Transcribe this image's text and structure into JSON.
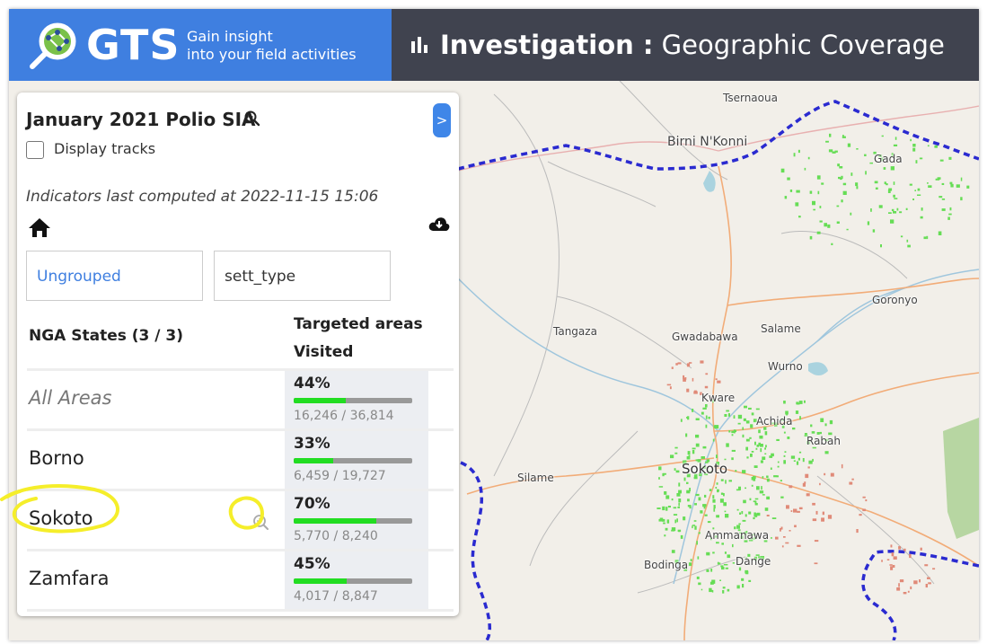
{
  "header": {
    "brand": "GTS",
    "tagline_line1": "Gain insight",
    "tagline_line2": "into your field activities",
    "title_bold": "Investigation :",
    "title_rest": " Geographic Coverage",
    "brand_color": "#3f7fe0",
    "title_bar_color": "#40434f"
  },
  "panel": {
    "survey_title": "January 2021 Polio SIA",
    "collapse_label": ">",
    "display_tracks_label": "Display tracks",
    "display_tracks_checked": false,
    "computed_text": "Indicators last computed at 2022-11-15 15:06",
    "groupings": [
      "Ungrouped",
      "sett_type"
    ],
    "table": {
      "col_state": "NGA States (3 / 3)",
      "col_metric_line1": "Targeted areas",
      "col_metric_line2": "Visited",
      "rows": [
        {
          "name": "All Areas",
          "pct": "44%",
          "fraction": 0.44,
          "count": "16,246 / 36,814"
        },
        {
          "name": "Borno",
          "pct": "33%",
          "fraction": 0.33,
          "count": "6,459 / 19,727"
        },
        {
          "name": "Sokoto",
          "pct": "70%",
          "fraction": 0.7,
          "count": "5,770 / 8,240"
        },
        {
          "name": "Zamfara",
          "pct": "45%",
          "fraction": 0.45,
          "count": "4,017 / 8,847"
        }
      ]
    }
  },
  "map": {
    "labels": {
      "tsernaoua": "Tsernaoua",
      "birni": "Birni N'Konni",
      "gada": "Gada",
      "goronyo": "Goronyo",
      "tangaza": "Tangaza",
      "gwadabawa": "Gwadabawa",
      "salame": "Salame",
      "wurno": "Wurno",
      "kware": "Kware",
      "achida": "Achida",
      "rabah": "Rabah",
      "sokoto": "Sokoto",
      "silame": "Silame",
      "ammanawa": "Ammanawa",
      "bodinga": "Bodinga",
      "dange": "Dange"
    },
    "border_color": "#2a2ad0",
    "visited_color": "#55dd55",
    "not_visited_color": "#e08070"
  },
  "icons": {
    "logo": "magnifier-globe-logo",
    "chart": "bar-chart-icon",
    "zoom": "zoom-in-icon",
    "home": "home-icon",
    "download": "cloud-download-icon"
  }
}
